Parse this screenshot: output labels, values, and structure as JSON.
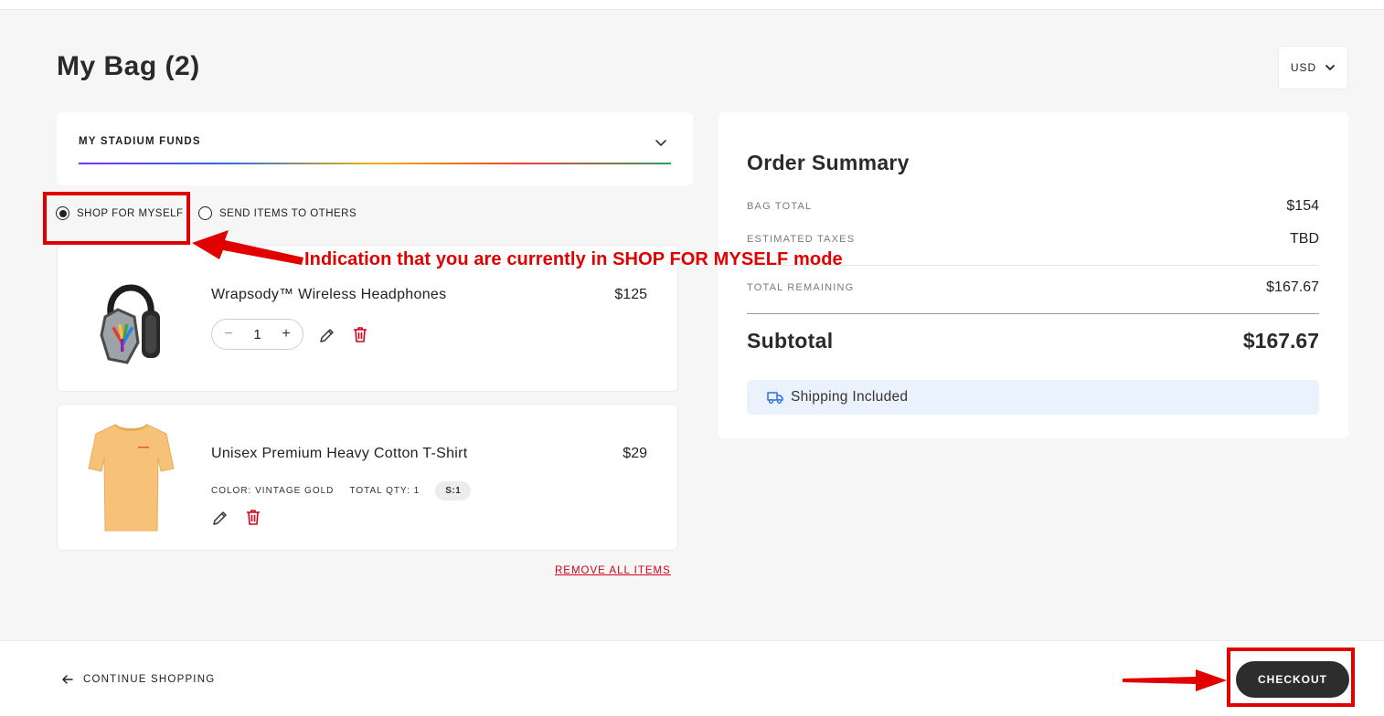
{
  "page": {
    "title": "My Bag (2)"
  },
  "currency": {
    "value": "USD"
  },
  "funds": {
    "label": "MY STADIUM FUNDS"
  },
  "modes": {
    "shop_for_myself": "SHOP FOR MYSELF",
    "send_to_others": "SEND ITEMS TO OTHERS",
    "selected": "shop_for_myself"
  },
  "annotation": {
    "text": "Indication that you are currently in SHOP FOR MYSELF mode"
  },
  "items": [
    {
      "name": "Wrapsody™ Wireless Headphones",
      "price": "$125",
      "quantity": "1",
      "decrement": "−",
      "increment": "+"
    },
    {
      "name": "Unisex Premium Heavy Cotton T-Shirt",
      "price": "$29",
      "color": "COLOR: VINTAGE GOLD",
      "total_qty": "TOTAL QTY: 1",
      "size": "S:1"
    }
  ],
  "remove_all": "REMOVE ALL ITEMS",
  "summary": {
    "title": "Order Summary",
    "bag_total_label": "BAG TOTAL",
    "bag_total_value": "$154",
    "taxes_label": "ESTIMATED TAXES",
    "taxes_value": "TBD",
    "remaining_label": "TOTAL REMAINING",
    "remaining_value": "$167.67",
    "subtotal_label": "Subtotal",
    "subtotal_value": "$167.67",
    "shipping": "Shipping Included"
  },
  "footer": {
    "continue_label": "CONTINUE SHOPPING",
    "checkout_label": "CHECKOUT"
  },
  "colors": {
    "annotation_red": "#e00000",
    "remove_red": "#d0021b",
    "checkout_bg": "#2d2d2d",
    "shipping_bg": "#eaf2fd"
  },
  "icons": [
    "chevron-down-icon",
    "pencil-icon",
    "trash-icon",
    "truck-icon",
    "arrow-left-icon",
    "headphones-image",
    "tshirt-image"
  ]
}
